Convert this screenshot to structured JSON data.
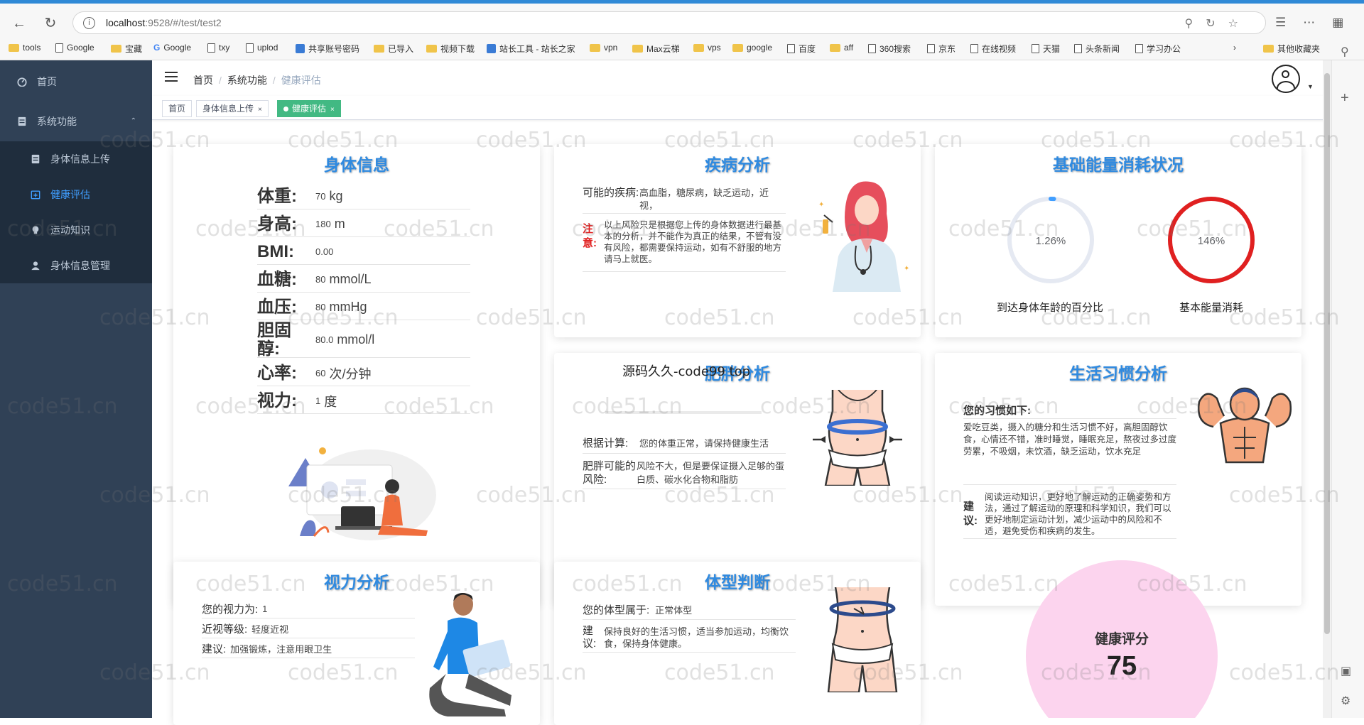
{
  "browser": {
    "url_host": "localhost",
    "url_path": ":9528/#/test/test2",
    "bookmarks": [
      "tools",
      "Google",
      "宝藏",
      "Google",
      "txy",
      "uplod",
      "共享账号密码",
      "已导入",
      "视频下载",
      "站长工具 - 站长之家",
      "vpn",
      "Max云梯",
      "vps",
      "google",
      "百度",
      "aff",
      "360搜索",
      "京东",
      "在线视频",
      "天猫",
      "头条新闻",
      "学习办公"
    ],
    "other_bookmarks": "其他收藏夹"
  },
  "sidebar": {
    "items": [
      {
        "label": "首页"
      },
      {
        "label": "系统功能"
      },
      {
        "label": "身体信息上传"
      },
      {
        "label": "健康评估"
      },
      {
        "label": "运动知识"
      },
      {
        "label": "身体信息管理"
      }
    ]
  },
  "breadcrumb": [
    "首页",
    "系统功能",
    "健康评估"
  ],
  "tags": [
    "首页",
    "身体信息上传",
    "健康评估"
  ],
  "body_info": {
    "title": "身体信息",
    "rows": [
      {
        "label": "体重:",
        "value": "70",
        "unit": "kg"
      },
      {
        "label": "身高:",
        "value": "180",
        "unit": "m"
      },
      {
        "label": "BMI:",
        "value": "0.00",
        "unit": ""
      },
      {
        "label": "血糖:",
        "value": "80",
        "unit": "mmol/L"
      },
      {
        "label": "血压:",
        "value": "80",
        "unit": "mmHg"
      },
      {
        "label": "胆固醇:",
        "value": "80.0",
        "unit": "mmol/l"
      },
      {
        "label": "心率:",
        "value": "60",
        "unit": "次/分钟"
      },
      {
        "label": "视力:",
        "value": "1",
        "unit": "度"
      }
    ]
  },
  "disease": {
    "title": "疾病分析",
    "possible_label": "可能的疾病:",
    "possible_value": "高血脂，糖尿病，缺乏运动，近视，",
    "note_label": "注意:",
    "note_value": "以上风险只是根据您上传的身体数据进行最基本的分析，并不能作为真正的结果，不管有没有风险，都需要保持运动，如有不舒服的地方请马上就医。"
  },
  "energy": {
    "title": "基础能量消耗状况",
    "gauges": [
      {
        "percent_text": "1.26%",
        "percent": 1.26,
        "caption": "到达身体年龄的百分比",
        "color": "#409eff"
      },
      {
        "percent_text": "146%",
        "percent": 146,
        "caption": "基本能量消耗",
        "color": "#e02020"
      }
    ]
  },
  "obesity": {
    "title": "肥胖分析",
    "overlay": "源码久久-code99 top",
    "calc_label": "根据计算:",
    "calc_value": "您的体重正常，请保持健康生活",
    "risk_label": "肥胖可能的风险:",
    "risk_value": "风险不大，但是要保证摄入足够的蛋白质、碳水化合物和脂肪"
  },
  "habits": {
    "title": "生活习惯分析",
    "intro": "您的习惯如下:",
    "habits_text": "爱吃豆类，摄入的糖分和生活习惯不好，高胆固醇饮食，心情还不错，准时睡觉，睡眠充足，熬夜过多过度劳累，不吸烟，未饮酒，缺乏运动，饮水充足",
    "advice_label": "建议:",
    "advice_text": "阅读运动知识，更好地了解运动的正确姿势和方法，通过了解运动的原理和科学知识，我们可以更好地制定运动计划，减少运动中的风险和不适，避免受伤和疾病的发生。"
  },
  "vision": {
    "title": "视力分析",
    "rows": [
      {
        "label": "您的视力为:",
        "value": "1"
      },
      {
        "label": "近视等级:",
        "value": "轻度近视"
      },
      {
        "label": "建议:",
        "value": "加强锻炼，注意用眼卫生"
      }
    ]
  },
  "body_type": {
    "title": "体型判断",
    "type_label": "您的体型属于:",
    "type_value": "正常体型",
    "advice_label": "建议:",
    "advice_value": "保持良好的生活习惯，适当参加运动，均衡饮食，保持身体健康。"
  },
  "score": {
    "label": "健康评分",
    "value": "75",
    "color": "#fcd4ee"
  },
  "watermark": "code51.cn"
}
